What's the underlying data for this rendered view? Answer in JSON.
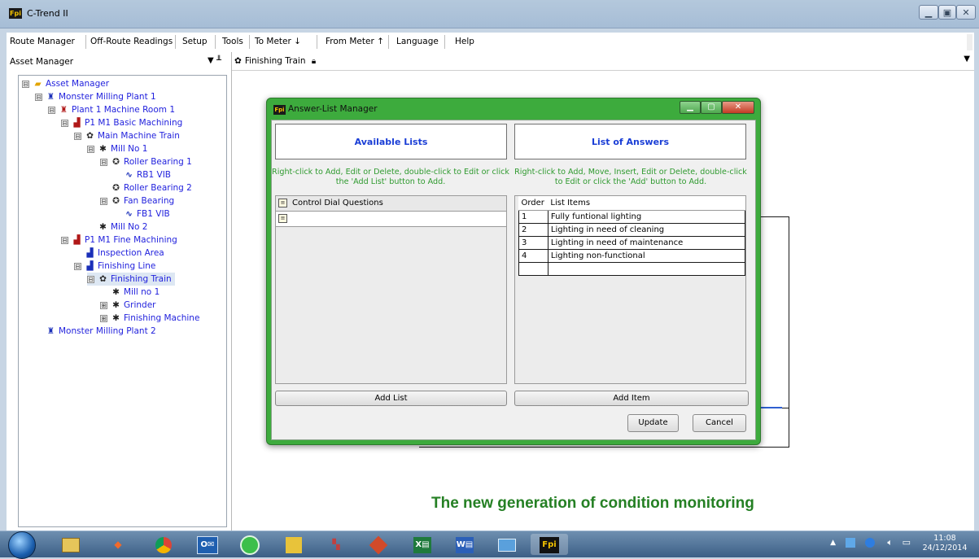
{
  "window": {
    "title": "C-Trend II",
    "icon": "Fpi",
    "controls": [
      "minimize",
      "maximize",
      "close"
    ]
  },
  "menu": [
    "Route Manager",
    "Off-Route Readings",
    "Setup",
    "Tools",
    "To Meter ↓",
    "From Meter ↑",
    "Language",
    "Help"
  ],
  "asset_panel": {
    "title": "Asset Manager",
    "tree": [
      {
        "label": "Asset Manager",
        "icon": "folder-icon",
        "expander": "⊟"
      },
      {
        "label": "Monster Milling Plant 1",
        "icon": "plant-icon",
        "expander": "⊟"
      },
      {
        "label": "Plant 1 Machine Room 1",
        "icon": "machine-room-icon",
        "expander": "⊟"
      },
      {
        "label": "P1 M1 Basic Machining",
        "icon": "area-icon",
        "expander": "⊟"
      },
      {
        "label": "Main Machine Train",
        "icon": "train-icon",
        "expander": "⊟"
      },
      {
        "label": "Mill No 1",
        "icon": "mill-icon",
        "expander": "⊟"
      },
      {
        "label": "Roller Bearing 1",
        "icon": "bearing-icon",
        "expander": "⊟"
      },
      {
        "label": "RB1 VIB",
        "icon": "vibration-icon",
        "expander": ""
      },
      {
        "label": "Roller Bearing 2",
        "icon": "bearing-icon",
        "expander": ""
      },
      {
        "label": "Fan Bearing",
        "icon": "bearing-icon",
        "expander": "⊟"
      },
      {
        "label": "FB1 VIB",
        "icon": "vibration-icon",
        "expander": ""
      },
      {
        "label": "Mill No 2",
        "icon": "mill-icon",
        "expander": ""
      },
      {
        "label": "P1 M1 Fine Machining",
        "icon": "area-icon",
        "expander": "⊟"
      },
      {
        "label": "Inspection Area",
        "icon": "area-icon",
        "expander": ""
      },
      {
        "label": "Finishing Line",
        "icon": "area-icon",
        "expander": "⊟"
      },
      {
        "label": "Finishing Train",
        "icon": "train-icon",
        "expander": "⊟"
      },
      {
        "label": "Mill no 1",
        "icon": "mill-icon",
        "expander": ""
      },
      {
        "label": "Grinder",
        "icon": "mill-icon",
        "expander": "⊞"
      },
      {
        "label": "Finishing Machine",
        "icon": "mill-icon",
        "expander": "⊞"
      },
      {
        "label": "Monster Milling Plant 2",
        "icon": "plant-icon",
        "expander": ""
      }
    ]
  },
  "document": {
    "tab_label": "Finishing Train",
    "slogan": "The new generation of condition monitoring"
  },
  "dialog": {
    "title": "Answer-List Manager",
    "left_header": "Available Lists",
    "right_header": "List of Answers",
    "left_hint": "Right-click to Add, Edit or Delete, double-click to Edit or click the 'Add List' button to Add.",
    "right_hint": "Right-click to Add, Move, Insert, Edit or Delete, double-click to Edit or click the 'Add' button to Add.",
    "available_lists": [
      "Control Dial Questions",
      ""
    ],
    "answers_columns": [
      "Order",
      "List Items"
    ],
    "answers": [
      {
        "order": "1",
        "item": "Fully funtional lighting"
      },
      {
        "order": "2",
        "item": "Lighting in need of cleaning"
      },
      {
        "order": "3",
        "item": "Lighting in need of maintenance"
      },
      {
        "order": "4",
        "item": "Lighting non-functional"
      },
      {
        "order": "",
        "item": ""
      }
    ],
    "add_list_label": "Add List",
    "add_item_label": "Add Item",
    "update_label": "Update",
    "cancel_label": "Cancel"
  },
  "taskbar": {
    "apps": [
      "start-orb",
      "file-explorer",
      "paint-icon",
      "chrome-icon",
      "outlook-icon",
      "app-green-icon",
      "app-yellow-icon",
      "app-chart-icon",
      "git-icon",
      "excel-icon",
      "word-icon",
      "remote-icon",
      "fpi-icon"
    ],
    "clock_time": "11:08",
    "clock_date": "24/12/2014"
  }
}
